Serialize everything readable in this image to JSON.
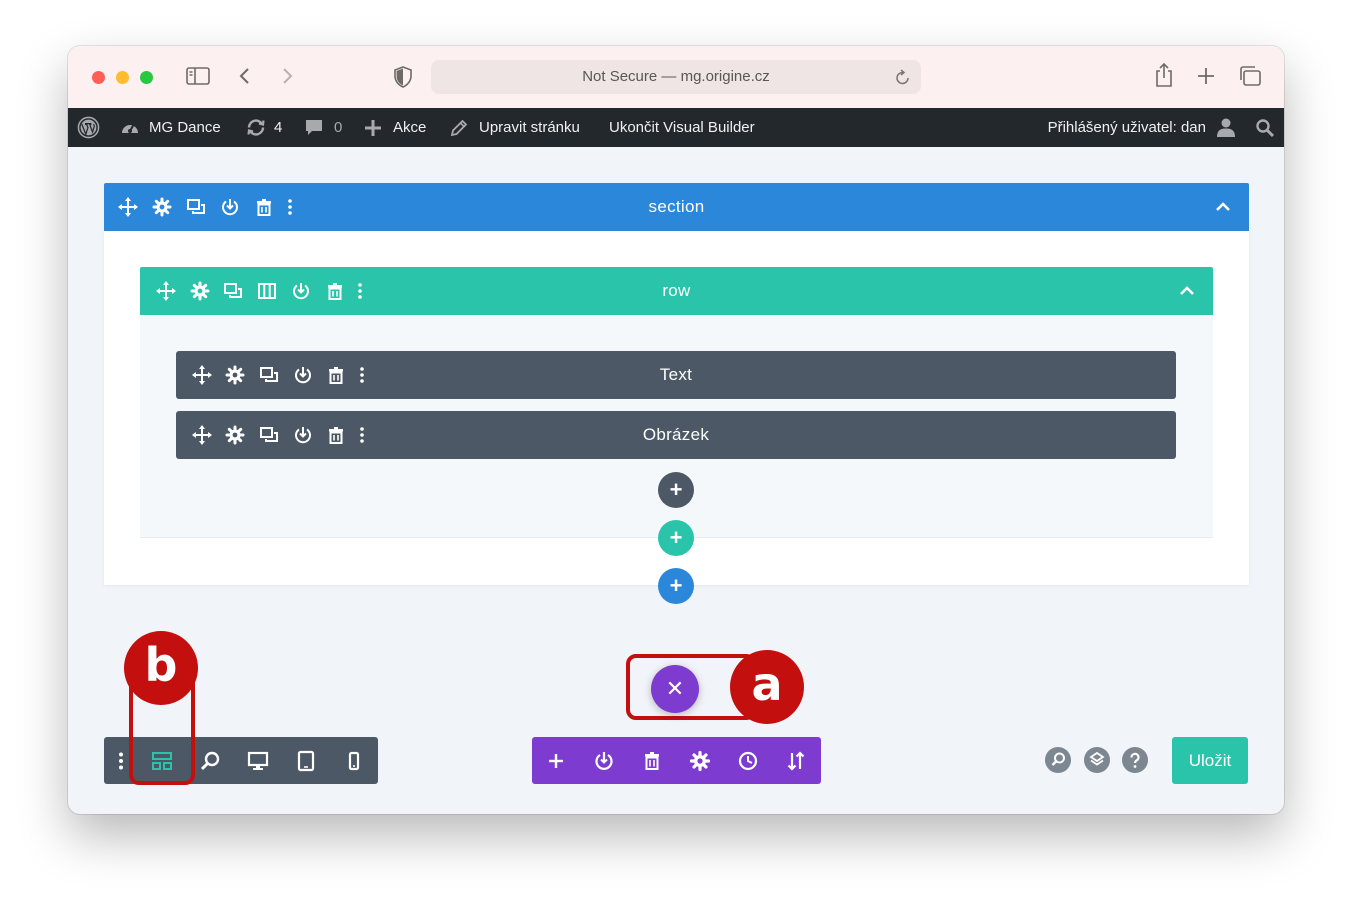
{
  "browser": {
    "url": "Not Secure — mg.origine.cz"
  },
  "adminbar": {
    "site_name": "MG Dance",
    "updates_count": "4",
    "comments_count": "0",
    "new_label": "Akce",
    "edit_label": "Upravit stránku",
    "exit_label": "Ukončit Visual Builder",
    "user_label": "Přihlášený uživatel: dan"
  },
  "builder": {
    "section_label": "section",
    "row_label": "row",
    "modules": [
      {
        "label": "Text"
      },
      {
        "label": "Obrázek"
      }
    ],
    "save_label": "Uložit"
  },
  "callouts": {
    "a": "a",
    "b": "b"
  },
  "colors": {
    "section": "#2b87da",
    "row": "#29c4a9",
    "module": "#4c5866",
    "page_toolbar": "#7e3bd0",
    "callout": "#c40f0f"
  }
}
